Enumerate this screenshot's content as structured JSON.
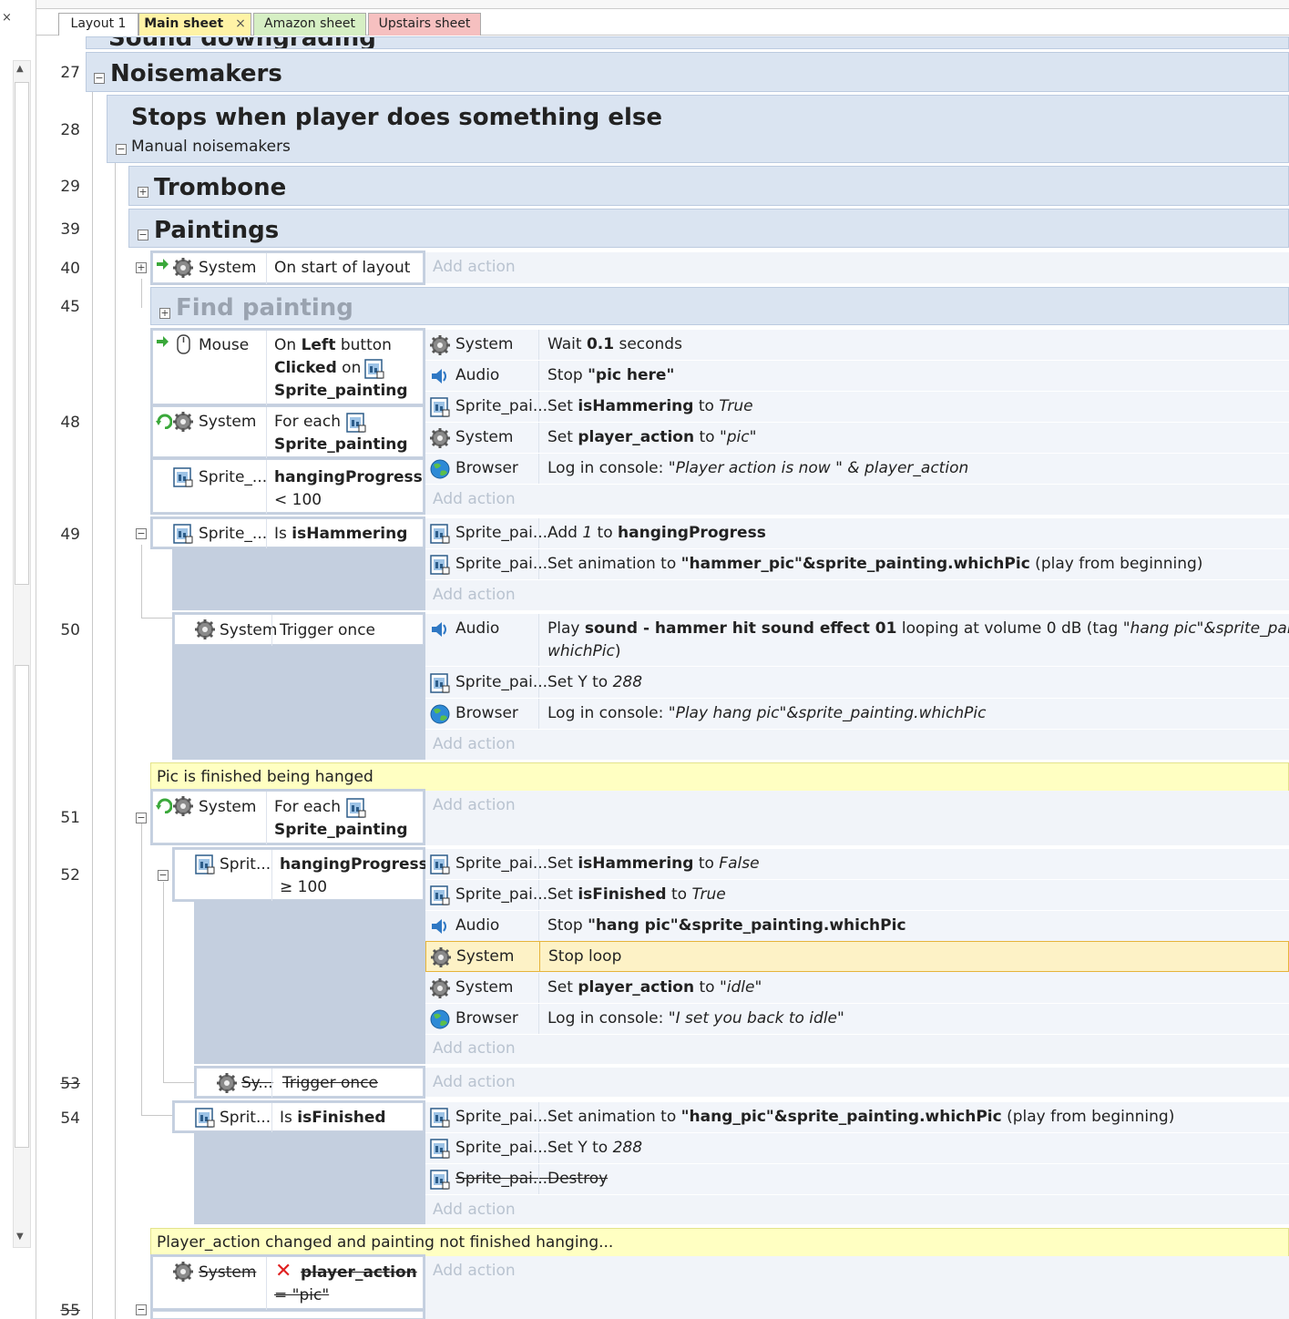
{
  "tabs": [
    {
      "label": "Layout 1"
    },
    {
      "label": "Main sheet",
      "close": "×"
    },
    {
      "label": "Amazon sheet"
    },
    {
      "label": "Upstairs sheet"
    }
  ],
  "topbar": {
    "partial_label": "Sound downgrading"
  },
  "line_numbers": {
    "n27": "27",
    "n28": "28",
    "n29": "29",
    "n39": "39",
    "n40": "40",
    "n45": "45",
    "n48": "48",
    "n49": "49",
    "n50": "50",
    "n51": "51",
    "n52": "52",
    "n53": "53",
    "n54": "54",
    "n55": "55"
  },
  "groups": {
    "noisemakers": "Noisemakers",
    "stops": {
      "title": "Stops when player does something else",
      "subtitle": "Manual noisemakers"
    },
    "trombone": "Trombone",
    "paintings": "Paintings",
    "find_painting": "Find painting"
  },
  "add_action": "Add action",
  "ev40": {
    "object": "System",
    "condition": "On start of layout"
  },
  "ev48": {
    "c1_object": "Mouse",
    "c1_pre": "On ",
    "c1_b1": "Left",
    "c1_mid": " button",
    "c1_b2": "Clicked",
    "c1_on": " on",
    "c1_b3": "Sprite_painting",
    "c2_object": "System",
    "c2_pre": "For each",
    "c2_b": "Sprite_painting",
    "c3_object": "Sprite_...",
    "c3_b": "hangingProgress",
    "c3_rest": "< 100",
    "actions": [
      {
        "object": "System",
        "icon": "gear-icon",
        "parts": [
          "Wait ",
          "0.1",
          " seconds"
        ]
      },
      {
        "object": "Audio",
        "icon": "speaker-icon",
        "parts": [
          "Stop ",
          "\"pic here\"",
          ""
        ]
      },
      {
        "object": "Sprite_pai...",
        "icon": "sprite-icon",
        "parts": [
          "Set ",
          "isHammering",
          " to ",
          "True"
        ]
      },
      {
        "object": "System",
        "icon": "gear-icon",
        "parts": [
          "Set ",
          "player_action",
          " to ",
          "\"pic\""
        ]
      },
      {
        "object": "Browser",
        "icon": "globe-icon",
        "parts": [
          "Log in console: ",
          "\"Player action is now \" & player_action"
        ]
      }
    ]
  },
  "ev49": {
    "object": "Sprite_...",
    "cond_pre": "Is ",
    "cond_b": "isHammering",
    "actions": [
      {
        "object": "Sprite_pai...",
        "parts": [
          "Add ",
          "1",
          " to ",
          "hangingProgress"
        ]
      },
      {
        "object": "Sprite_pai...",
        "parts": [
          "Set animation to ",
          "\"hammer_pic\"&sprite_painting.whichPic",
          " (play from beginning)"
        ]
      }
    ]
  },
  "ev50": {
    "object": "System",
    "condition": "Trigger once",
    "a1_object": "Audio",
    "a1_pre": "Play ",
    "a1_b": "sound - hammer hit sound effect 01",
    "a1_mid": " looping at volume 0 dB (tag ",
    "a1_i": "\"hang pic\"&sprite_painting.",
    "a1_line2": "whichPic",
    "a1_end": ")",
    "a2_object": "Sprite_pai...",
    "a2_pre": "Set Y to ",
    "a2_i": "288",
    "a3_object": "Browser",
    "a3_pre": "Log in console: ",
    "a3_i": "\"Play hang pic\"&sprite_painting.whichPic"
  },
  "comment1": "Pic is finished being hanged",
  "ev51": {
    "object": "System",
    "pre": "For each",
    "b": "Sprite_painting"
  },
  "ev52": {
    "object": "Sprit...",
    "cond_b": "hangingProgress",
    "cond_rest": "≥ 100",
    "actions": [
      {
        "object": "Sprite_pai...",
        "parts": [
          "Set ",
          "isHammering",
          " to ",
          "False"
        ]
      },
      {
        "object": "Sprite_pai...",
        "parts": [
          "Set ",
          "isFinished",
          " to ",
          "True"
        ]
      },
      {
        "object": "Audio",
        "parts": [
          "Stop ",
          "\"hang pic\"&sprite_painting.whichPic"
        ]
      },
      {
        "object": "System",
        "parts": [
          "Stop loop"
        ]
      },
      {
        "object": "System",
        "parts": [
          "Set ",
          "player_action",
          " to ",
          "\"idle\""
        ]
      },
      {
        "object": "Browser",
        "parts": [
          "Log in console: ",
          "\"I set you back to idle\""
        ]
      }
    ]
  },
  "ev53": {
    "object": "Sy...",
    "condition": "Trigger once"
  },
  "ev54": {
    "object": "Sprit...",
    "cond_pre": "Is ",
    "cond_b": "isFinished",
    "a1_object": "Sprite_pai...",
    "a1_pre": "Set animation to ",
    "a1_b": "\"hang_pic\"&sprite_painting.whichPic",
    "a1_end": " (play from beginning)",
    "a2_object": "Sprite_pai...",
    "a2_pre": "Set Y to ",
    "a2_i": "288",
    "a3_object": "Sprite_pai...",
    "a3_text": "Destroy"
  },
  "comment2": "Player_action changed and painting not finished hanging...",
  "ev55": {
    "object": "System",
    "cond_b": "player_action",
    "cond_rest": "= \"pic\""
  },
  "colors": {
    "group_bg": "#dae4f1",
    "block_bg": "#c4cfdf",
    "comment_bg": "#ffffc2",
    "highlight": "#fdf2c6",
    "tab_main": "#fff3a6",
    "tab_amazon": "#d6efc4",
    "tab_upstairs": "#f6c0c0"
  }
}
